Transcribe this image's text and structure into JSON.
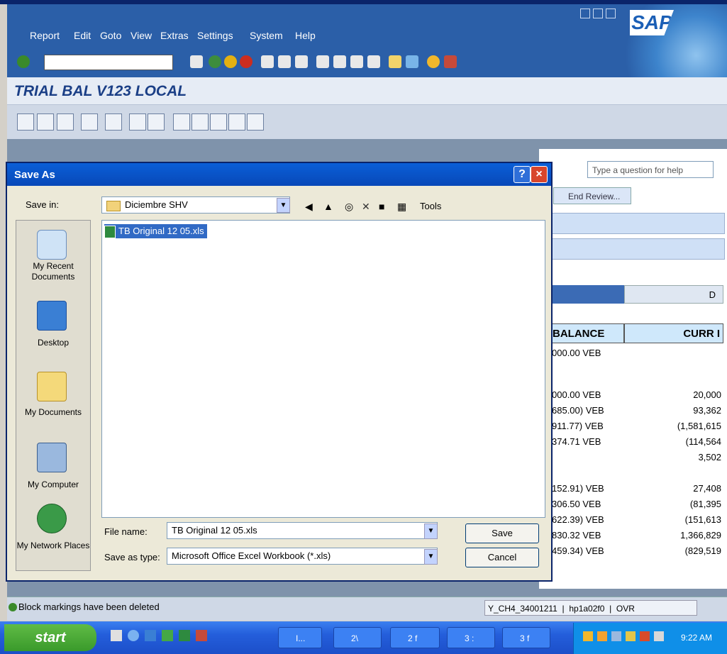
{
  "sap": {
    "menu": [
      "Report",
      "Edit",
      "Goto",
      "View",
      "Extras",
      "Settings",
      "System",
      "Help"
    ],
    "logo": "SAP",
    "page_title": "TRIAL BAL V123 LOCAL",
    "status_message": "Block markings have been deleted",
    "status_session": "Y_CH4_34001211",
    "status_host": "hp1a02f0",
    "status_mode": "OVR"
  },
  "excel": {
    "help_placeholder": "Type a question for help",
    "end_review": "End Review...",
    "column_letter": "D",
    "header_balance": "BALANCE",
    "header_curr": "CURR I",
    "balance_cells": [
      "000.00 VEB",
      "000.00 VEB",
      "685.00) VEB",
      "911.77) VEB",
      "374.71 VEB",
      "152.91) VEB",
      "306.50 VEB",
      "622.39) VEB",
      "830.32 VEB",
      "459.34) VEB"
    ],
    "curr_cells": [
      "20,000",
      "93,362",
      "(1,581,615",
      "(114,564",
      "3,502",
      "27,408",
      "(81,395",
      "(151,613",
      "1,366,829",
      "(829,519"
    ]
  },
  "dialog": {
    "title": "Save As",
    "save_in_label": "Save in:",
    "save_in_value": "Diciembre SHV",
    "tools_label": "Tools",
    "places": [
      "My Recent Documents",
      "Desktop",
      "My Documents",
      "My Computer",
      "My Network Places"
    ],
    "files": [
      "TB Original 12 05.xls"
    ],
    "file_name_label": "File name:",
    "file_name_value": "TB Original 12 05.xls",
    "save_as_type_label": "Save as type:",
    "save_as_type_value": "Microsoft Office Excel Workbook (*.xls)",
    "save_button": "Save",
    "cancel_button": "Cancel"
  },
  "taskbar": {
    "start": "start",
    "tasks": [
      "I...",
      "2\\",
      "2 f",
      "3 :",
      "3 f"
    ],
    "clock": "9:22 AM"
  },
  "colors": {
    "sap_blue": "#2b5fa8",
    "xp_title": "#0a5fd8",
    "selection": "#316ac5",
    "taskbar": "#245edb"
  }
}
